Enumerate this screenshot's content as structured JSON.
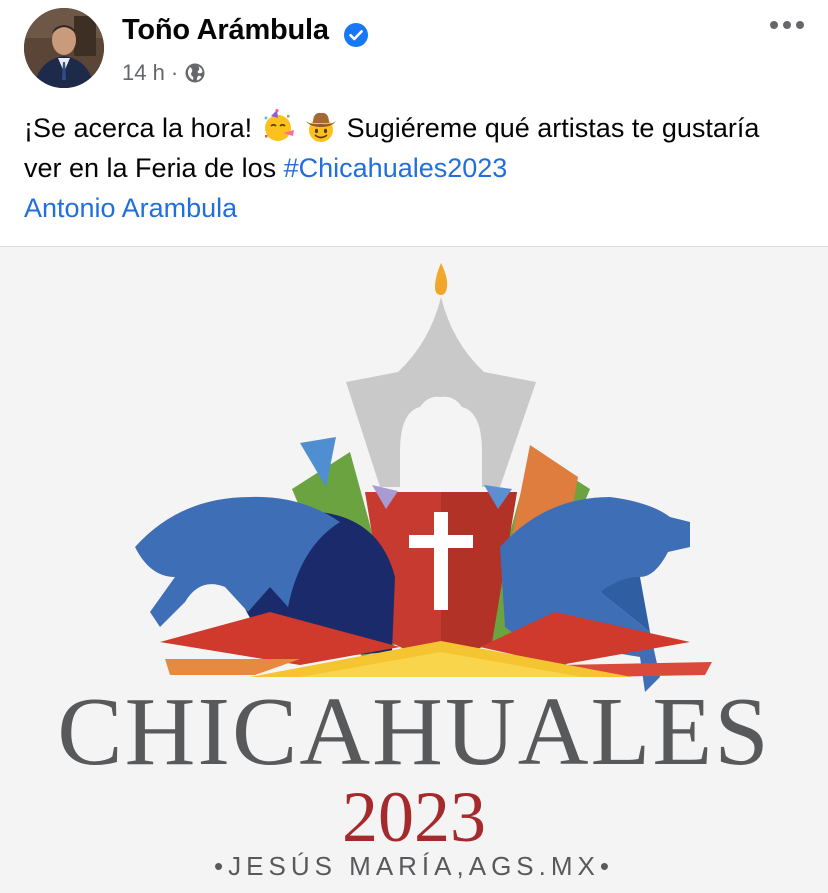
{
  "post": {
    "author": "Toño Arámbula",
    "verified": true,
    "timestamp": "14 h",
    "separator": "·",
    "audience_icon": "globe-icon",
    "text_part1": "¡Se acerca la hora!",
    "emoji_1": "partying-face-emoji",
    "emoji_2": "cowboy-hat-face-emoji",
    "text_part2": "Sugiéreme qué artistas te gustaría ver en la Feria de los",
    "hashtag": "#Chicahuales2023",
    "mention": "Antonio Arambula"
  },
  "image": {
    "wordmark": "CHICAHUALES",
    "year": "2023",
    "location": "•JESÚS MARÍA,AGS.MX•"
  },
  "colors": {
    "link": "#216fdb",
    "verified_badge": "#1877f2",
    "meta_text": "#65676b",
    "logo_gray": "#58595b",
    "logo_red": "#a42a2e"
  }
}
